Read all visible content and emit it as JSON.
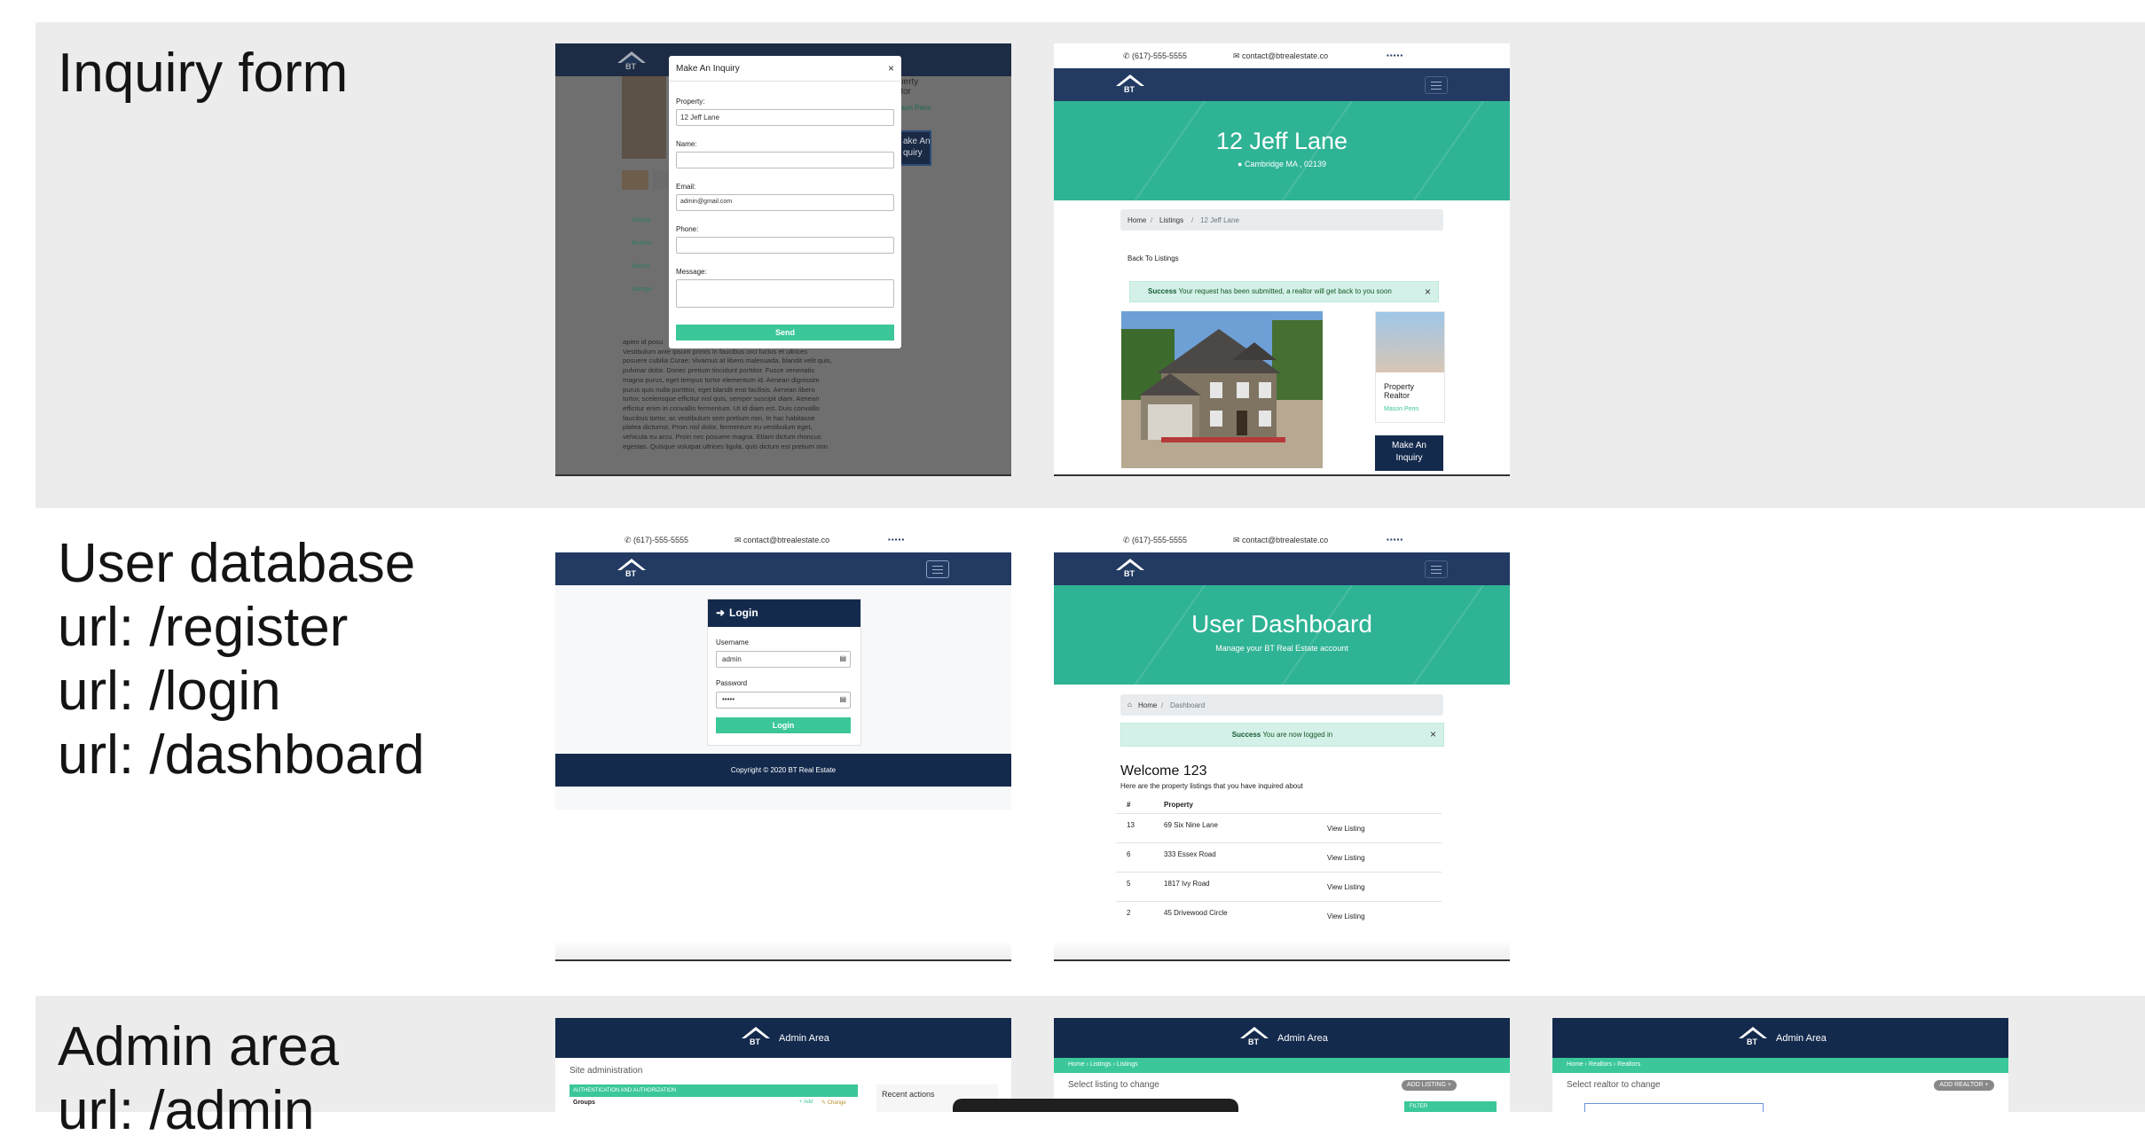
{
  "rows": [
    {
      "title": "Inquiry form"
    },
    {
      "title": "User database\nurl: /register\nurl: /login\nurl: /dashboard"
    },
    {
      "title": "Admin area\nurl: /admin"
    }
  ],
  "site": {
    "phone": "(617)-555-5555",
    "email": "contact@btrealestate.co",
    "logo_text": "BT",
    "social_icons": [
      "twitter-icon",
      "facebook-icon",
      "linkedin-icon",
      "instagram-icon",
      "pinterest-icon"
    ],
    "colors": {
      "navy": "#233b62",
      "dark_navy": "#142a4d",
      "green": "#3bc79a",
      "hero": "#2fb395"
    }
  },
  "inquiry_modal": {
    "title": "Make An Inquiry",
    "close": "×",
    "property_label": "Property:",
    "property_value": "12 Jeff Lane",
    "name_label": "Name:",
    "name_value": "",
    "email_label": "Email:",
    "email_value": "admin@gmail.com",
    "phone_label": "Phone:",
    "phone_value": "",
    "message_label": "Message:",
    "message_value": "",
    "send": "Send",
    "bg_realtor_fragment": "perty\nltor",
    "bg_realtor_name": "son Penn",
    "bg_inquiry_button": "ake An\nquiry",
    "bg_features": [
      "Asking",
      "Bedroo",
      "Bathro",
      "Garage"
    ],
    "bg_lorem": "apien id posu\nVestibulum ante ipsum primis in faucibus orci luctus et ultrices\nposuere cubilia Curae; Vivamus at libero malesuada, blandit velit quis,\npulvinar dolor. Donec pretium tincidunt porttitor. Fusce venenatis\nmagna purus, eget tempus tortor elementum id. Aenean dignissim\npurus quis nulla porttitor, eget blandit erat facilisis. Aenean libero\ntortor, scelerisque efficitur nisl quis, semper suscipit diam. Aenean\nefficitur enim in convallis fermentum. Ut id diam est. Duis convallis\nfaucibus tortor, ac vestibulum sem pretium non. In hac habitasse\nplatea dictumst. Proin nisl dolor, fermentum eu vestibulum eget,\nvehicula eu arcu. Proin nec posuere magna. Etiam dictum rhoncus\negestas. Quisque volutpat ultrices ligula, quis dictum est pretium non."
  },
  "listing": {
    "title": "12 Jeff Lane",
    "location": "Cambridge MA , 02139",
    "breadcrumb": [
      "Home",
      "Listings",
      "12 Jeff Lane"
    ],
    "back": "Back To Listings",
    "alert_strong": "Success",
    "alert_text": "Your request has been submitted, a realtor will get back to you soon",
    "alert_close": "×",
    "realtor_title": "Property\nRealtor",
    "realtor_name": "Mason Penn",
    "inquiry_button": "Make An\nInquiry"
  },
  "login": {
    "header": "Login",
    "username_label": "Username",
    "username_value": "admin",
    "password_label": "Password",
    "password_value": "•••••",
    "button": "Login",
    "footer": "Copyright © 2020 BT Real Estate"
  },
  "dashboard": {
    "hero_title": "User Dashboard",
    "hero_subtitle": "Manage your BT Real Estate account",
    "breadcrumb_home": "Home",
    "breadcrumb_current": "Dashboard",
    "alert_strong": "Success",
    "alert_text": "You are now logged in",
    "alert_close": "×",
    "welcome": "Welcome 123",
    "intro": "Here are the property listings that you have inquired about",
    "col_num": "#",
    "col_property": "Property",
    "rows": [
      {
        "id": "13",
        "property": "69 Six Nine Lane",
        "action": "View Listing"
      },
      {
        "id": "6",
        "property": "333 Essex Road",
        "action": "View Listing"
      },
      {
        "id": "5",
        "property": "1817 Ivy Road",
        "action": "View Listing"
      },
      {
        "id": "2",
        "property": "45 Drivewood Circle",
        "action": "View Listing"
      }
    ]
  },
  "admin": {
    "brand": "Admin Area",
    "site_admin": "Site administration",
    "auth_header": "AUTHENTICATION AND AUTHORIZATION",
    "groups": "Groups",
    "add": "+ Add",
    "change": "✎ Change",
    "recent_actions": "Recent actions",
    "listings_crumb": "Home › Listings › Listings",
    "select_listing": "Select listing to change",
    "add_listing": "ADD LISTING +",
    "filter": "FILTER",
    "realtors_crumb": "Home › Realtors › Realtors",
    "select_realtor": "Select realtor to change",
    "add_realtor": "ADD REALTOR +"
  }
}
